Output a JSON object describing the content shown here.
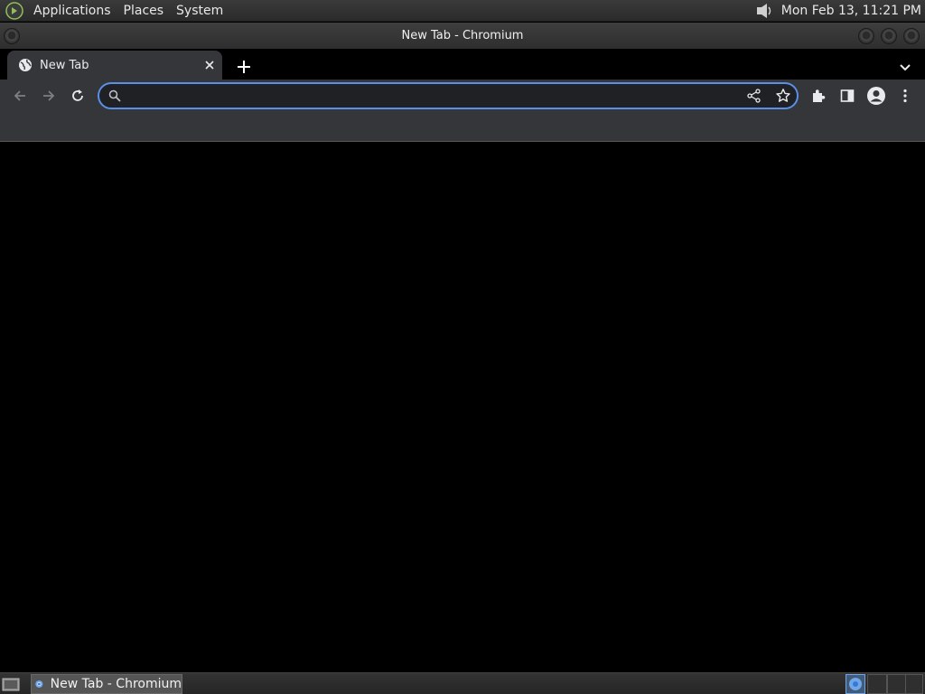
{
  "top_panel": {
    "menus": [
      "Applications",
      "Places",
      "System"
    ],
    "clock": "Mon Feb 13, 11:21 PM"
  },
  "window": {
    "title": "New Tab - Chromium"
  },
  "tabs": [
    {
      "label": "New Tab",
      "active": true
    }
  ],
  "omnibox": {
    "value": "",
    "placeholder": ""
  },
  "taskbar": {
    "items": [
      {
        "label": "New Tab - Chromium"
      }
    ]
  },
  "colors": {
    "accent": "#5b8fe6",
    "toolbar": "#35363a",
    "content_bg": "#000000"
  }
}
